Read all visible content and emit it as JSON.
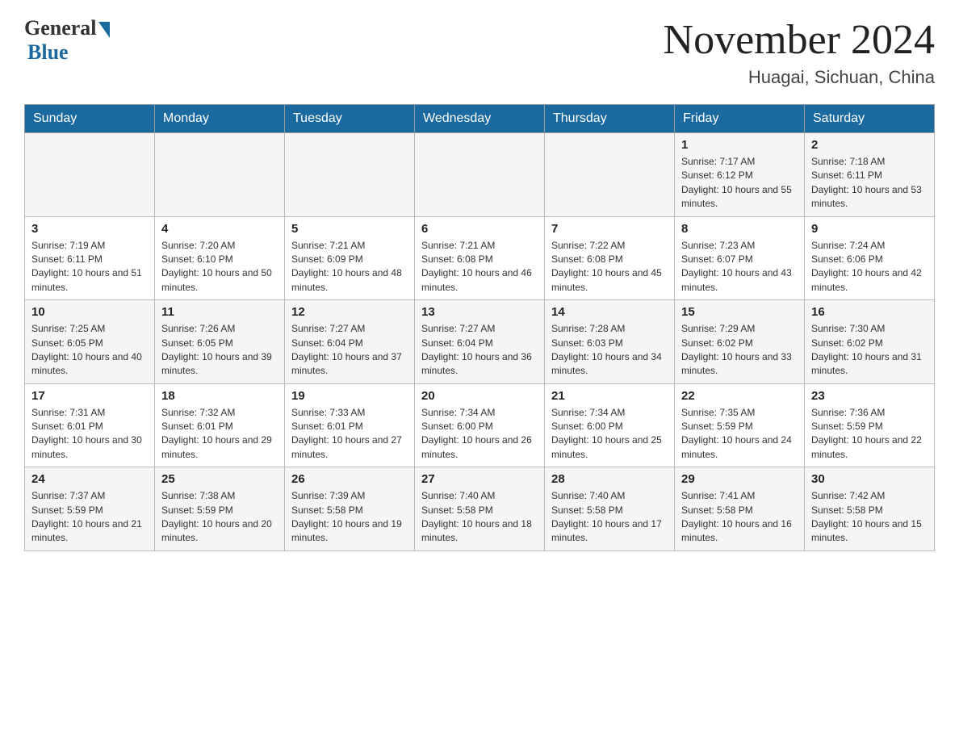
{
  "header": {
    "logo_general": "General",
    "logo_blue": "Blue",
    "month_title": "November 2024",
    "location": "Huagai, Sichuan, China"
  },
  "weekdays": [
    "Sunday",
    "Monday",
    "Tuesday",
    "Wednesday",
    "Thursday",
    "Friday",
    "Saturday"
  ],
  "weeks": [
    [
      {
        "day": "",
        "info": ""
      },
      {
        "day": "",
        "info": ""
      },
      {
        "day": "",
        "info": ""
      },
      {
        "day": "",
        "info": ""
      },
      {
        "day": "",
        "info": ""
      },
      {
        "day": "1",
        "info": "Sunrise: 7:17 AM\nSunset: 6:12 PM\nDaylight: 10 hours and 55 minutes."
      },
      {
        "day": "2",
        "info": "Sunrise: 7:18 AM\nSunset: 6:11 PM\nDaylight: 10 hours and 53 minutes."
      }
    ],
    [
      {
        "day": "3",
        "info": "Sunrise: 7:19 AM\nSunset: 6:11 PM\nDaylight: 10 hours and 51 minutes."
      },
      {
        "day": "4",
        "info": "Sunrise: 7:20 AM\nSunset: 6:10 PM\nDaylight: 10 hours and 50 minutes."
      },
      {
        "day": "5",
        "info": "Sunrise: 7:21 AM\nSunset: 6:09 PM\nDaylight: 10 hours and 48 minutes."
      },
      {
        "day": "6",
        "info": "Sunrise: 7:21 AM\nSunset: 6:08 PM\nDaylight: 10 hours and 46 minutes."
      },
      {
        "day": "7",
        "info": "Sunrise: 7:22 AM\nSunset: 6:08 PM\nDaylight: 10 hours and 45 minutes."
      },
      {
        "day": "8",
        "info": "Sunrise: 7:23 AM\nSunset: 6:07 PM\nDaylight: 10 hours and 43 minutes."
      },
      {
        "day": "9",
        "info": "Sunrise: 7:24 AM\nSunset: 6:06 PM\nDaylight: 10 hours and 42 minutes."
      }
    ],
    [
      {
        "day": "10",
        "info": "Sunrise: 7:25 AM\nSunset: 6:05 PM\nDaylight: 10 hours and 40 minutes."
      },
      {
        "day": "11",
        "info": "Sunrise: 7:26 AM\nSunset: 6:05 PM\nDaylight: 10 hours and 39 minutes."
      },
      {
        "day": "12",
        "info": "Sunrise: 7:27 AM\nSunset: 6:04 PM\nDaylight: 10 hours and 37 minutes."
      },
      {
        "day": "13",
        "info": "Sunrise: 7:27 AM\nSunset: 6:04 PM\nDaylight: 10 hours and 36 minutes."
      },
      {
        "day": "14",
        "info": "Sunrise: 7:28 AM\nSunset: 6:03 PM\nDaylight: 10 hours and 34 minutes."
      },
      {
        "day": "15",
        "info": "Sunrise: 7:29 AM\nSunset: 6:02 PM\nDaylight: 10 hours and 33 minutes."
      },
      {
        "day": "16",
        "info": "Sunrise: 7:30 AM\nSunset: 6:02 PM\nDaylight: 10 hours and 31 minutes."
      }
    ],
    [
      {
        "day": "17",
        "info": "Sunrise: 7:31 AM\nSunset: 6:01 PM\nDaylight: 10 hours and 30 minutes."
      },
      {
        "day": "18",
        "info": "Sunrise: 7:32 AM\nSunset: 6:01 PM\nDaylight: 10 hours and 29 minutes."
      },
      {
        "day": "19",
        "info": "Sunrise: 7:33 AM\nSunset: 6:01 PM\nDaylight: 10 hours and 27 minutes."
      },
      {
        "day": "20",
        "info": "Sunrise: 7:34 AM\nSunset: 6:00 PM\nDaylight: 10 hours and 26 minutes."
      },
      {
        "day": "21",
        "info": "Sunrise: 7:34 AM\nSunset: 6:00 PM\nDaylight: 10 hours and 25 minutes."
      },
      {
        "day": "22",
        "info": "Sunrise: 7:35 AM\nSunset: 5:59 PM\nDaylight: 10 hours and 24 minutes."
      },
      {
        "day": "23",
        "info": "Sunrise: 7:36 AM\nSunset: 5:59 PM\nDaylight: 10 hours and 22 minutes."
      }
    ],
    [
      {
        "day": "24",
        "info": "Sunrise: 7:37 AM\nSunset: 5:59 PM\nDaylight: 10 hours and 21 minutes."
      },
      {
        "day": "25",
        "info": "Sunrise: 7:38 AM\nSunset: 5:59 PM\nDaylight: 10 hours and 20 minutes."
      },
      {
        "day": "26",
        "info": "Sunrise: 7:39 AM\nSunset: 5:58 PM\nDaylight: 10 hours and 19 minutes."
      },
      {
        "day": "27",
        "info": "Sunrise: 7:40 AM\nSunset: 5:58 PM\nDaylight: 10 hours and 18 minutes."
      },
      {
        "day": "28",
        "info": "Sunrise: 7:40 AM\nSunset: 5:58 PM\nDaylight: 10 hours and 17 minutes."
      },
      {
        "day": "29",
        "info": "Sunrise: 7:41 AM\nSunset: 5:58 PM\nDaylight: 10 hours and 16 minutes."
      },
      {
        "day": "30",
        "info": "Sunrise: 7:42 AM\nSunset: 5:58 PM\nDaylight: 10 hours and 15 minutes."
      }
    ]
  ]
}
